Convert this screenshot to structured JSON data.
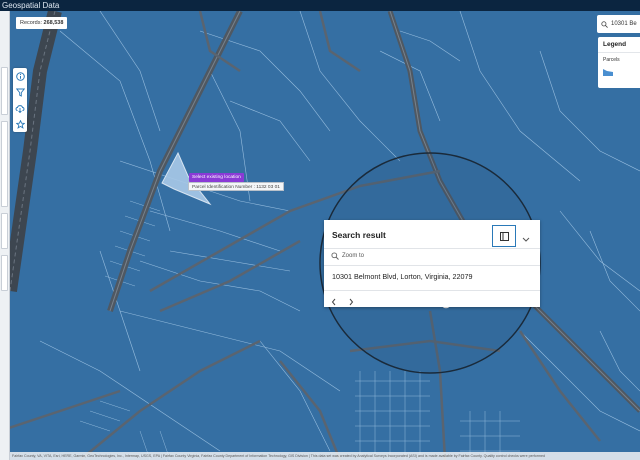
{
  "app": {
    "title": "Geospatial Data"
  },
  "records": {
    "label": "Records:",
    "count": "268,538"
  },
  "search": {
    "value": "10301 Be"
  },
  "legend": {
    "title": "Legend",
    "layer": "Parcels",
    "swatch_color": "#4a8fd0"
  },
  "tooltip": {
    "text": "Select existing location"
  },
  "pin_label": {
    "text": "Parcel Identification Number : 1132 03 01"
  },
  "popup": {
    "title": "Search result",
    "zoom_label": "Zoom to",
    "address": "10301 Belmont Blvd, Lorton, Virginia, 22079"
  },
  "attribution": "Fairfax County, VA, VITA, Esri, HERE, Garmin, GeoTechnologies, Inc., Intermap, USGS, EPA | Fairfax County Virginia, Fairfax County Department of Information Technology, GIS Division | This data set was created by Analytical Surveys Incorporated (ASI) and is made available by Fairfax County. Quality control checks were performed",
  "colors": {
    "map_fill": "#356fa3",
    "road": "#5a6470",
    "parcel_line": "#9fc3e6",
    "accent": "#8a3ad6"
  }
}
